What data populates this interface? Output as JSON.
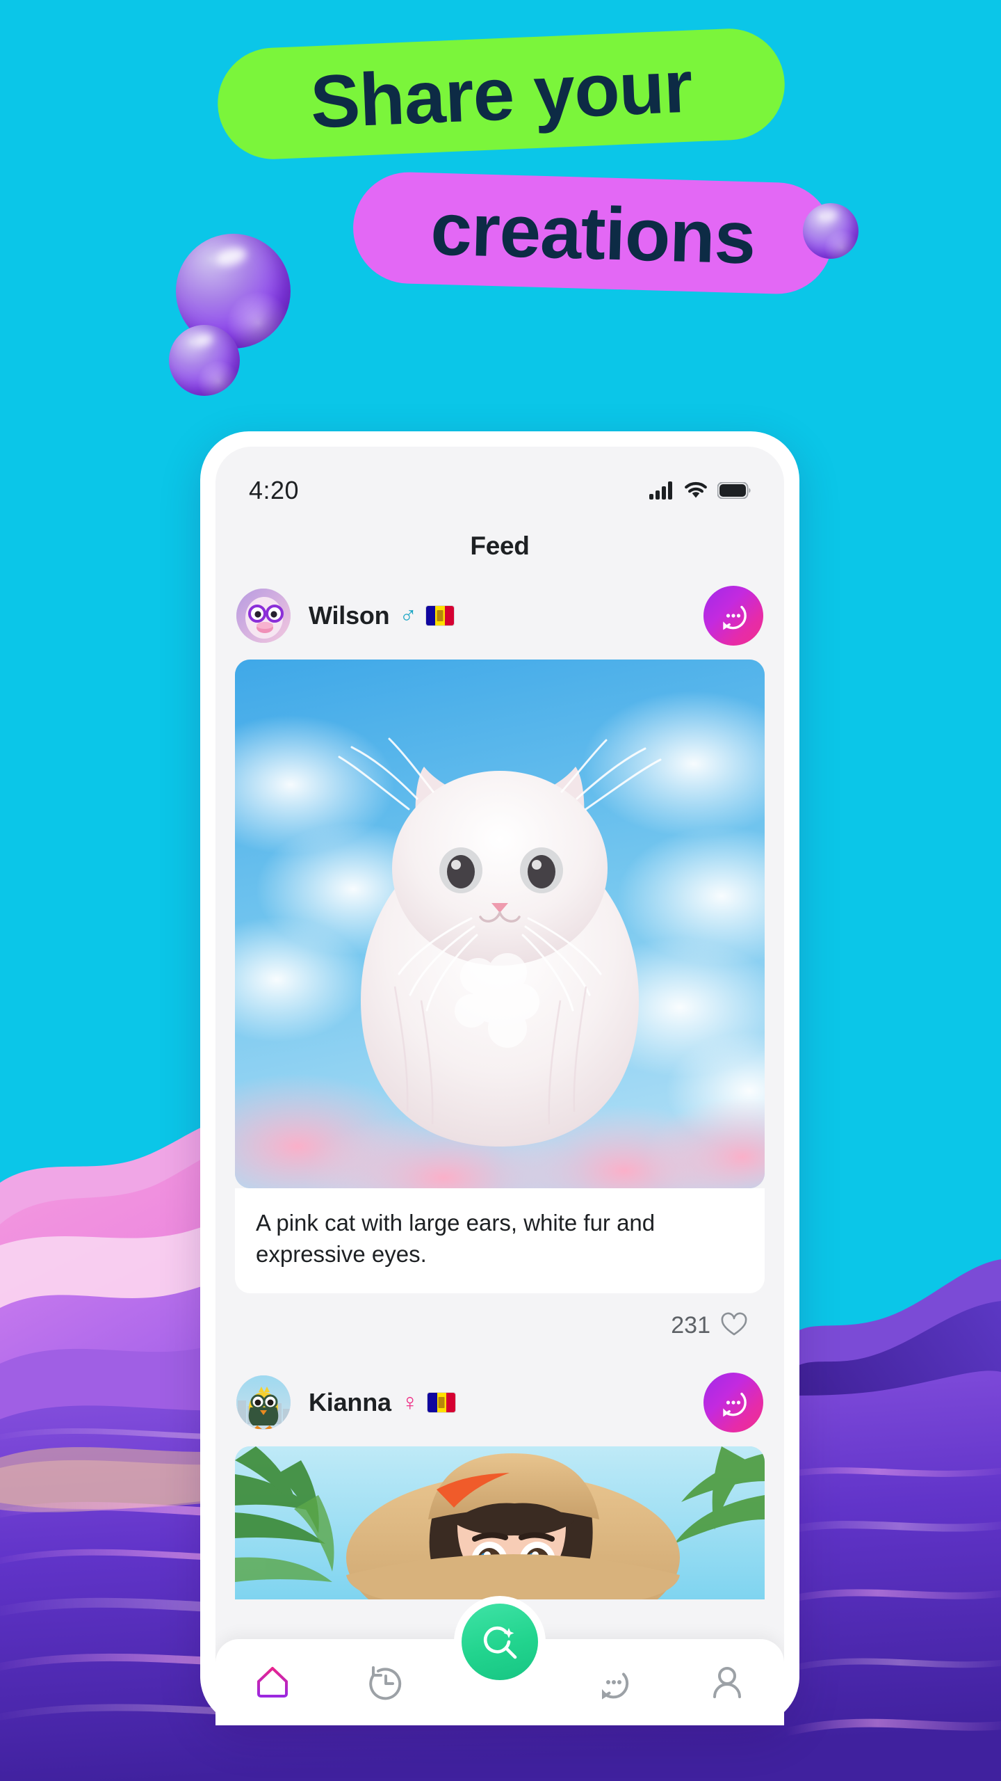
{
  "theme": {
    "background_cyan": "#0BC6E8",
    "pill_green": "#7BF53B",
    "pill_magenta": "#E368F5",
    "headline_text_color": "#0D2B45",
    "accent_gradient_start": "#A12BE8",
    "accent_gradient_end": "#F0308E",
    "fab_green": "#22D48E",
    "sphere_purple": "#8B3FF0"
  },
  "headline": {
    "line1": "Share your",
    "line2": "creations"
  },
  "phone": {
    "status_bar": {
      "time": "4:20",
      "icons": [
        "cellular-signal-icon",
        "wifi-icon",
        "battery-icon"
      ]
    },
    "screen_title": "Feed",
    "posts": [
      {
        "user_name": "Wilson",
        "gender_symbol": "♂",
        "gender": "male",
        "country_flag": "andorra-flag",
        "avatar_alt": "duck-with-purple-glasses-avatar",
        "chat_button_icon": "chat-bubble-dots-icon",
        "image_alt": "white fluffy persian cat sitting on pink clouds in blue sky",
        "caption": "A pink cat with large ears, white fur and expressive eyes.",
        "like_count": "231",
        "like_icon": "heart-outline-icon"
      },
      {
        "user_name": "Kianna",
        "gender_symbol": "♀",
        "gender": "female",
        "country_flag": "andorra-flag",
        "avatar_alt": "yellow-bird-with-glasses-avatar",
        "chat_button_icon": "chat-bubble-dots-icon",
        "image_alt": "3d cartoon girl wearing straw hat in tropical palm scene"
      }
    ],
    "bottom_nav": {
      "items": [
        {
          "name": "home",
          "icon": "home-icon",
          "active": true
        },
        {
          "name": "history",
          "icon": "clock-history-icon",
          "active": false
        },
        {
          "name": "create",
          "icon": "magic-search-icon",
          "active": false
        },
        {
          "name": "messages",
          "icon": "chat-bubble-dots-icon",
          "active": false
        },
        {
          "name": "profile",
          "icon": "user-person-icon",
          "active": false
        }
      ]
    }
  }
}
